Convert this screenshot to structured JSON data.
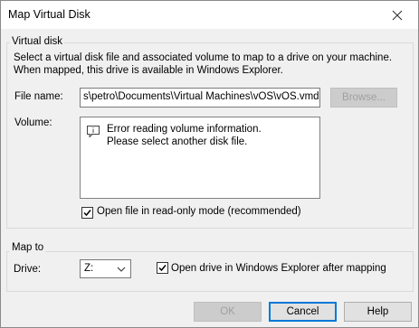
{
  "window": {
    "title": "Map Virtual Disk"
  },
  "virtual_disk": {
    "legend": "Virtual disk",
    "description_line1": "Select a virtual disk file and associated volume to map to a drive on your machine.",
    "description_line2": "When mapped, this drive is available in Windows Explorer.",
    "file_name_label": "File name:",
    "file_name_value": "s\\petro\\Documents\\Virtual Machines\\vOS\\vOS.vmdk",
    "browse_label": "Browse...",
    "volume_label": "Volume:",
    "volume_message_line1": "Error reading volume information.",
    "volume_message_line2": "Please select another disk file.",
    "readonly_label": "Open file in read-only mode (recommended)",
    "readonly_checked": true
  },
  "map_to": {
    "legend": "Map to",
    "drive_label": "Drive:",
    "drive_value": "Z:",
    "open_explorer_label": "Open drive in Windows Explorer after mapping",
    "open_explorer_checked": true
  },
  "buttons": {
    "ok": "OK",
    "cancel": "Cancel",
    "help": "Help"
  }
}
